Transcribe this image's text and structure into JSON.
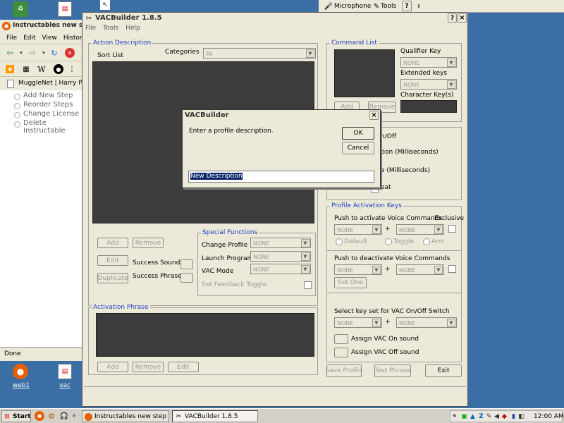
{
  "desktop": {
    "icons": [
      {
        "name": "web1",
        "label": "web1"
      },
      {
        "name": "vac",
        "label": "vac"
      }
    ]
  },
  "browser": {
    "title": "Instructables new ste",
    "menu": [
      "File",
      "Edit",
      "View",
      "History"
    ],
    "tab": "MuggleNet | Harry Pott",
    "links": [
      "Add New Step",
      "Reorder Steps",
      "Change License",
      "Delete Instructable"
    ],
    "status": "Done"
  },
  "toolbar": {
    "microphone": "Microphone",
    "tools": "Tools",
    "help": "?"
  },
  "window": {
    "title": "VACBuilder 1.8.5",
    "menu": [
      "File",
      "Tools",
      "Help"
    ],
    "help_btn": "?",
    "close_btn": "×",
    "action": {
      "group_label": "Action Description",
      "sort_list": "Sort List",
      "categories_label": "Categories",
      "categories_value": "All",
      "add": "Add",
      "remove": "Remove",
      "edit": "Edit",
      "duplicate": "Duplicate",
      "success_sound": "Success Sound",
      "success_phrase": "Success Phrase"
    },
    "special": {
      "group_label": "Special Functions",
      "change_profile": "Change Profile",
      "launch_program": "Launch Program",
      "vac_mode": "VAC Mode",
      "feedback_toggle": "Set Feedback Toggle",
      "none": "NONE"
    },
    "activation": {
      "group_label": "Activation Phrase",
      "add": "Add",
      "remove": "Remove",
      "edit": "Edit"
    },
    "command": {
      "group_label": "Command List",
      "qualifier_key": "Qualifier Key",
      "extended_keys": "Extended keys",
      "character_keys": "Character Key(s)",
      "none": "NONE",
      "add": "Add",
      "remove": "Remove"
    },
    "partial": {
      "onoff": "n/Off",
      "ms1": "tion (Milliseconds)",
      "ms2": "e (Milliseconds)",
      "eat": "eat"
    },
    "profile": {
      "group_label": "Profile Activation Keys",
      "push_activate": "Push to activate Voice Commands",
      "exclusive": "Exclusive",
      "default": "Default",
      "toggle": "Toggle",
      "arm": "Arm",
      "push_deactivate": "Push to deactivate Voice Commands",
      "set_one": "Set One",
      "select_keyset": "Select key set for VAC On/Off Switch",
      "assign_on": "Assign VAC On sound",
      "assign_off": "Assign VAC Off sound",
      "none": "NONE",
      "plus": "+"
    },
    "bottom": {
      "save_profile": "Save Profile",
      "test_phrase": "Test Phrase",
      "exit": "Exit"
    }
  },
  "dialog": {
    "title": "VACBuilder",
    "message": "Enter a profile description.",
    "ok": "OK",
    "cancel": "Cancel",
    "input_value": "New Description",
    "close": "×"
  },
  "taskbar": {
    "start": "Start",
    "btn1": "Instructables new step : ...",
    "btn2": "VACBuilder 1.8.5",
    "tray_arrows": "«",
    "time": "12:00 AM"
  },
  "colors": {
    "desktop": "#3a6ea5",
    "group_label": "#1f3ec7",
    "selection": "#0a246a",
    "dark_panel": "#3c3c3c"
  }
}
